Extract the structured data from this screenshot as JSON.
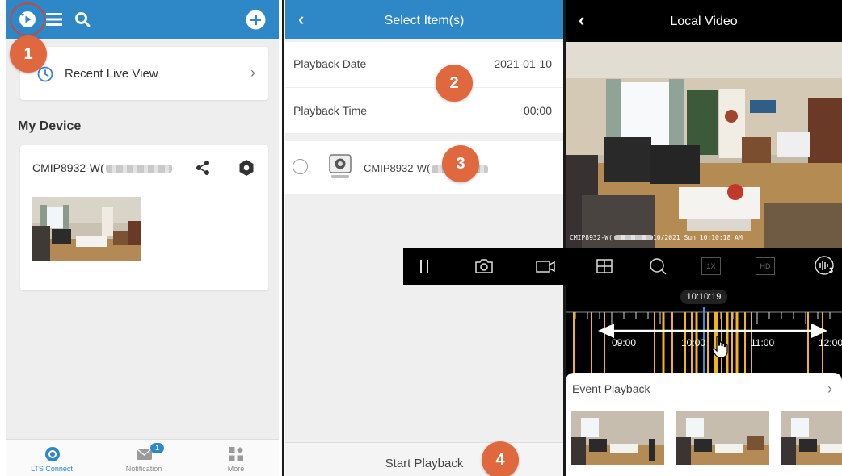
{
  "steps": [
    "1",
    "2",
    "3",
    "4"
  ],
  "home": {
    "recent_label": "Recent Live View",
    "my_device_heading": "My Device",
    "device_name": "CMIP8932-W(",
    "nav": [
      {
        "label": "LTS Connect",
        "active": true
      },
      {
        "label": "Notification",
        "badge": "1"
      },
      {
        "label": "More"
      }
    ]
  },
  "select_items": {
    "title": "Select Item(s)",
    "date_label": "Playback Date",
    "date_value": "2021-01-10",
    "time_label": "Playback Time",
    "time_value": "00:00",
    "device_name": "CMIP8932-W(",
    "start_label": "Start Playback"
  },
  "local_video": {
    "title": "Local Video",
    "osd_name": "CMIP8932-W(",
    "osd_time": "10/2021 Sun 10:10:18 AM",
    "current_time": "10:10:19",
    "timeline_labels": [
      "09:00",
      "10:00",
      "11:00",
      "12:00"
    ],
    "event_playback_label": "Event Playback",
    "quality_1": "1X",
    "quality_2": "HD",
    "audio_channel": "3"
  },
  "colors": {
    "header_blue": "#2e87c6",
    "step_orange": "#e0683f",
    "ring_red": "#c7483b",
    "record_yellow": "#f2b51a",
    "cursor_blue": "#3a8fd8"
  }
}
